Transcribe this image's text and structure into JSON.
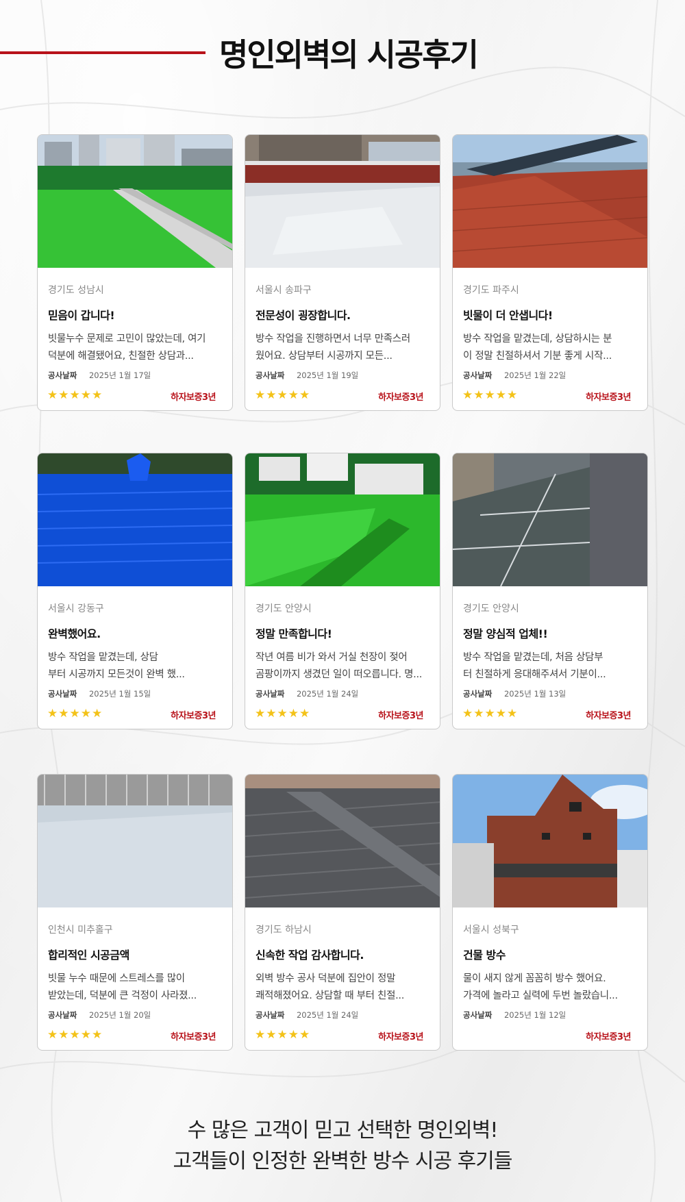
{
  "page_title": "명인외벽의 시공후기",
  "accent_color": "#b8121a",
  "star_color": "#f3c218",
  "reviews": [
    {
      "location": "경기도 성남시",
      "title": "믿음이 갑니다!",
      "line1": "빗물누수 문제로 고민이 많았는데, 여기",
      "line2": "덕분에 해결됐어요, 친절한 상담과...",
      "date_label": "공사날짜",
      "date": "2025년 1월 17일",
      "stars": "★★★★★",
      "rating": 5,
      "warranty": "하자보증3년"
    },
    {
      "location": "서울시 송파구",
      "title": "전문성이 굉장합니다.",
      "line1": "방수 작업을 진행하면서 너무 만족스러",
      "line2": "웠어요. 상담부터 시공까지 모든...",
      "date_label": "공사날짜",
      "date": "2025년 1월 19일",
      "stars": "★★★★★",
      "rating": 5,
      "warranty": "하자보증3년"
    },
    {
      "location": "경기도 파주시",
      "title": "빗물이 더 안샙니다!",
      "line1": "방수 작업을 맡겼는데, 상담하시는 분",
      "line2": "이 정말 친절하셔서 기분 좋게 시작...",
      "date_label": "공사날짜",
      "date": "2025년 1월 22일",
      "stars": "★★★★★",
      "rating": 5,
      "warranty": "하자보증3년"
    },
    {
      "location": "서울시 강동구",
      "title": "완벽했어요.",
      "line1": "방수 작업을 맡겼는데, 상담",
      "line2": "부터 시공까지 모든것이 완벽 했...",
      "date_label": "공사날짜",
      "date": "2025년 1월 15일",
      "stars": "★★★★★",
      "rating": 5,
      "warranty": "하자보증3년"
    },
    {
      "location": "경기도 안양시",
      "title": "정말 만족합니다!",
      "line1": "작년 여름 비가 와서 거실 천장이 젖어",
      "line2": "곰팡이까지 생겼던 일이 떠오릅니다. 명...",
      "date_label": "공사날짜",
      "date": "2025년 1월 24일",
      "stars": "★★★★★",
      "rating": 5,
      "warranty": "하자보증3년"
    },
    {
      "location": "경기도 안양시",
      "title": "정말 양심적 업체!!",
      "line1": "방수 작업을 맡겼는데, 처음 상담부",
      "line2": "터 친절하게 응대해주셔서 기분이...",
      "date_label": "공사날짜",
      "date": "2025년 1월 13일",
      "stars": "★★★★★",
      "rating": 5,
      "warranty": "하자보증3년"
    },
    {
      "location": "인천시 미추홀구",
      "title": "합리적인 시공금액",
      "line1": "빗물 누수 때문에 스트레스를 많이",
      "line2": "받았는데, 덕분에 큰 걱정이 사라졌...",
      "date_label": "공사날짜",
      "date": "2025년 1월 20일",
      "stars": "★★★★★",
      "rating": 5,
      "warranty": "하자보증3년"
    },
    {
      "location": "경기도 하남시",
      "title": "신속한 작업 감사합니다.",
      "line1": "외벽 방수 공사 덕분에 집안이 정말",
      "line2": "쾌적해졌어요. 상담할 때 부터 친절...",
      "date_label": "공사날짜",
      "date": "2025년 1월 24일",
      "stars": "★★★★★",
      "rating": 5,
      "warranty": "하자보증3년"
    },
    {
      "location": "서울시 성북구",
      "title": "건물 방수",
      "line1": "물이 새지 않게 꼼꼼히 방수 했어요.",
      "line2": "가격에 놀라고 실력에 두번 놀랐습니...",
      "date_label": "공사날짜",
      "date": "2025년 1월 12일",
      "stars": "",
      "rating": 0,
      "warranty": "하자보증3년"
    }
  ],
  "footer": {
    "line1": "수 많은 고객이 믿고 선택한 명인외벽!",
    "line2": "고객들이 인정한 완벽한 방수 시공 후기들"
  }
}
